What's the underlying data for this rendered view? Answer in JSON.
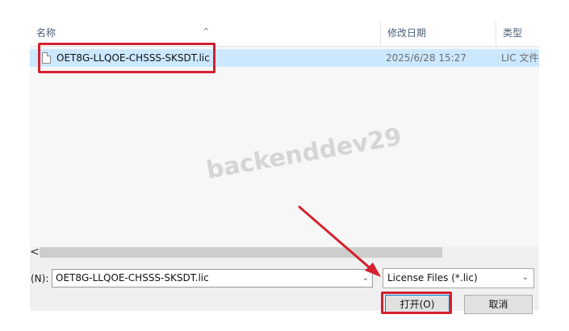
{
  "columns": {
    "name": "名称",
    "date": "修改日期",
    "type": "类型"
  },
  "sort_indicator": "^",
  "file": {
    "name": "OET8G-LLQOE-CHSSS-SKSDT.lic",
    "modified": "2025/6/28 15:27",
    "type": "LIC 文件"
  },
  "watermark": "backenddev29",
  "scrollbar": {
    "left_arrow": "<"
  },
  "filename_field": {
    "label": "(N):",
    "value": "OET8G-LLQOE-CHSSS-SKSDT.lic"
  },
  "filter": {
    "value": "License Files (*.lic)"
  },
  "buttons": {
    "open": "打开(O)",
    "cancel": "取消"
  },
  "annotation_color": "#d5202e",
  "icons": {
    "file": "file-icon",
    "dropdown": "chevron-down-icon"
  }
}
